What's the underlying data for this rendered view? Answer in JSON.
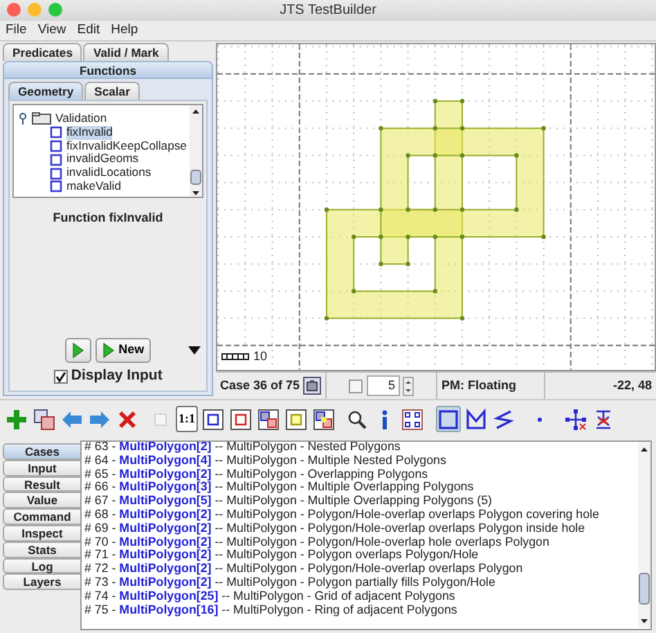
{
  "window": {
    "title": "JTS TestBuilder"
  },
  "menu": [
    "File",
    "View",
    "Edit",
    "Help"
  ],
  "left_panel": {
    "tabs": [
      {
        "label": "Predicates",
        "selected": false
      },
      {
        "label": "Valid / Mark",
        "selected": false
      },
      {
        "label": "Functions",
        "selected": true
      }
    ],
    "subtabs": [
      {
        "label": "Geometry",
        "selected": true
      },
      {
        "label": "Scalar",
        "selected": false
      }
    ],
    "tree": [
      {
        "label": "Validation",
        "expanded": true,
        "children": [
          {
            "label": "fixInvalid",
            "selected": true
          },
          {
            "label": "fixInvalidKeepCollapse",
            "selected": false
          },
          {
            "label": "invalidGeoms",
            "selected": false
          },
          {
            "label": "invalidLocations",
            "selected": false
          },
          {
            "label": "makeValid",
            "selected": false
          }
        ]
      }
    ],
    "function_label": "Function fixInvalid",
    "buttons": [
      {
        "kind": "run"
      },
      {
        "kind": "run",
        "label": "New"
      }
    ],
    "display_input": {
      "label": "Display Input",
      "checked": true
    }
  },
  "canvas": {
    "scale_label": "10"
  },
  "status": {
    "case": "Case 36 of 75",
    "show_labels": {
      "checked": false
    },
    "spinner": "5",
    "precision": "PM: Floating",
    "coords": "-22, 48"
  },
  "toolbar": {
    "actions": [
      {
        "kind": "add"
      },
      {
        "kind": "copy"
      },
      {
        "kind": "back"
      },
      {
        "kind": "forward"
      },
      {
        "kind": "delete"
      },
      {
        "kind": "blank",
        "disabled": true
      },
      {
        "kind": "text",
        "label": "1:1"
      },
      {
        "kind": "box-a"
      },
      {
        "kind": "box-b"
      },
      {
        "kind": "box-ab"
      },
      {
        "kind": "box-result"
      },
      {
        "kind": "box-all"
      },
      {
        "kind": "zoom"
      },
      {
        "kind": "info"
      },
      {
        "kind": "grid"
      }
    ],
    "tools": [
      {
        "kind": "rectangle",
        "selected": true
      },
      {
        "kind": "polygon",
        "selected": false
      },
      {
        "kind": "line",
        "selected": false
      },
      {
        "kind": "point",
        "selected": false
      },
      {
        "kind": "pan",
        "selected": false
      },
      {
        "kind": "edit",
        "selected": false
      }
    ]
  },
  "side_tabs": [
    {
      "label": "Cases",
      "selected": true
    },
    {
      "label": "Input",
      "selected": false
    },
    {
      "label": "Result",
      "selected": false
    },
    {
      "label": "Value",
      "selected": false
    },
    {
      "label": "Command",
      "selected": false
    },
    {
      "label": "Inspect",
      "selected": false
    },
    {
      "label": "Stats",
      "selected": false
    },
    {
      "label": "Log",
      "selected": false
    },
    {
      "label": "Layers",
      "selected": false
    }
  ],
  "cases": [
    "# 63 - **MultiPolygon[2]** -- MultiPolygon - Nested Polygons",
    "# 64 - **MultiPolygon[4]** -- MultiPolygon - Multiple Nested Polygons",
    "# 65 - **MultiPolygon[2]** -- MultiPolygon - Overlapping Polygons",
    "# 66 - **MultiPolygon[3]** -- MultiPolygon - Multiple Overlapping Polygons",
    "# 67 - **MultiPolygon[5]** -- MultiPolygon - Multiple Overlapping Polygons (5)",
    "# 68 - **MultiPolygon[2]** -- MultiPolygon - Polygon/Hole-overlap overlaps Polygon covering hole",
    "# 69 - **MultiPolygon[2]** -- MultiPolygon - Polygon/Hole-overlap overlaps Polygon inside hole",
    "# 70 - **MultiPolygon[2]** -- MultiPolygon - Polygon/Hole-overlap hole overlaps Polygon",
    "# 71 - **MultiPolygon[2]** -- MultiPolygon - Polygon overlaps Polygon/Hole",
    "# 72 - **MultiPolygon[2]** -- MultiPolygon - Polygon/Hole-overlap overlaps Polygon",
    "# 73 - **MultiPolygon[2]** -- MultiPolygon - Polygon partially fills Polygon/Hole",
    "# 74 - **MultiPolygon[25]** -- MultiPolygon - Grid of adjacent Polygons",
    "# 75 - **MultiPolygon[16]** -- MultiPolygon - Ring of adjacent Polygons"
  ]
}
